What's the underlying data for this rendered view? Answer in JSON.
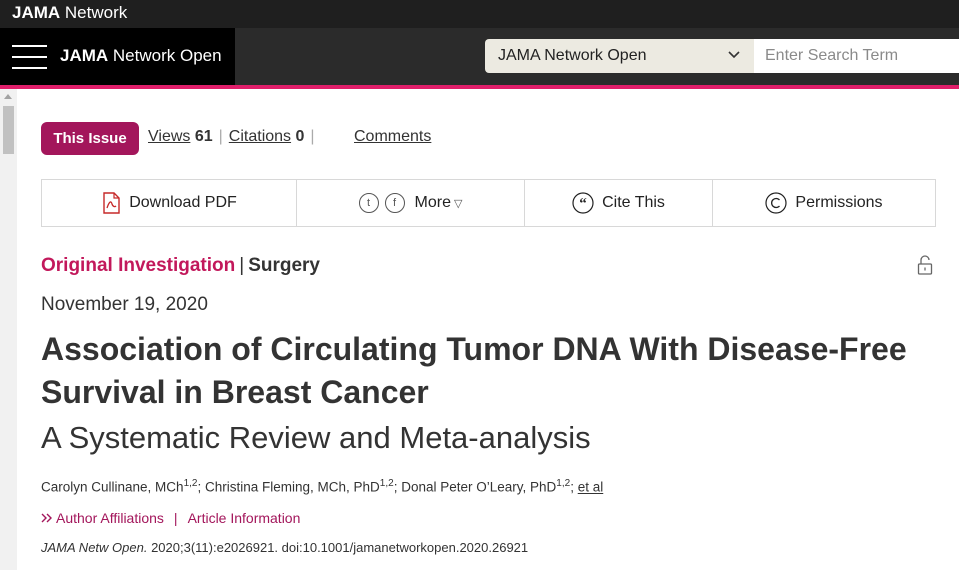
{
  "topbar": {
    "brand_bold": "JAMA",
    "brand_rest": " Network"
  },
  "navbar": {
    "journal_bold": "JAMA",
    "journal_rest": " Network Open",
    "select_value": "JAMA Network Open",
    "search_placeholder": "Enter Search Term"
  },
  "article_meta": {
    "issue_label": "This Issue",
    "views_label": "Views",
    "views_count": "61",
    "citations_label": "Citations",
    "citations_count": "0",
    "comments_label": "Comments"
  },
  "toolbar": {
    "download_pdf": "Download PDF",
    "twitter_glyph": "t",
    "facebook_glyph": "f",
    "more_label": "More",
    "more_caret": "▽",
    "cite_label": "Cite This",
    "permissions_label": "Permissions"
  },
  "article": {
    "type": "Original Investigation",
    "topic_separator": "|",
    "topic": "Surgery",
    "date": "November 19, 2020",
    "title": "Association of Circulating Tumor DNA With Disease-Free Survival in Breast Cancer",
    "subtitle": "A Systematic Review and Meta-analysis",
    "authors": [
      {
        "name": "Carolyn Cullinane, MCh",
        "sup": "1,2",
        "sep": "; "
      },
      {
        "name": "Christina Fleming, MCh, PhD",
        "sup": "1,2",
        "sep": "; "
      },
      {
        "name": "Donal Peter O’Leary, PhD",
        "sup": "1,2",
        "sep": "; "
      }
    ],
    "et_al": "et al",
    "author_affiliations": "Author Affiliations",
    "affil_separator": "|",
    "article_information": "Article Information",
    "citation_journal": "JAMA Netw Open.",
    "citation_rest": " 2020;3(11):e2026921. doi:10.1001/jamanetworkopen.2020.26921"
  },
  "colors": {
    "accent": "#e01e6a",
    "brand": "#a3165b",
    "dark": "#1f1f1f"
  },
  "icons": [
    "hamburger-icon",
    "chevron-down-icon",
    "pdf-icon",
    "twitter-icon",
    "facebook-icon",
    "quote-icon",
    "copyright-icon",
    "unlock-icon"
  ]
}
